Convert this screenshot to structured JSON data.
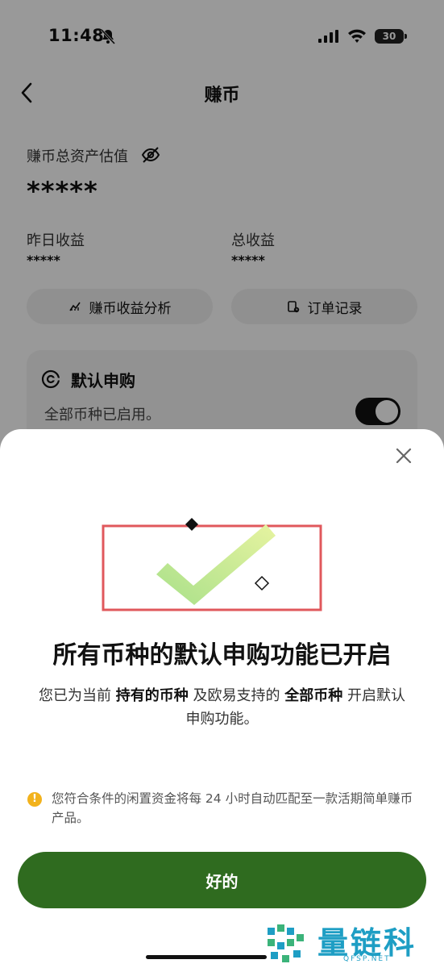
{
  "status_bar": {
    "time": "11:48",
    "battery": "30"
  },
  "nav": {
    "title": "赚币"
  },
  "assets": {
    "total_label": "赚币总资产估值",
    "total_value": "*****",
    "yesterday_label": "昨日收益",
    "yesterday_value": "*****",
    "total_earnings_label": "总收益",
    "total_earnings_value": "*****"
  },
  "actions": {
    "analysis_label": "赚币收益分析",
    "orders_label": "订单记录"
  },
  "default_subscribe": {
    "title": "默认申购",
    "status": "全部币种已启用。",
    "enabled": true
  },
  "sheet": {
    "title": "所有币种的默认申购功能已开启",
    "desc_part1": "您已为当前 ",
    "desc_bold1": "持有的币种",
    "desc_part2": " 及欧易支持的 ",
    "desc_bold2": "全部币种",
    "desc_part3": " 开启默认申购功能。",
    "notice_icon": "!",
    "notice": "您符合条件的闲置资金将每 24 小时自动匹配至一款活期简单赚币产品。",
    "ok_label": "好的"
  },
  "watermark": {
    "name": "量链科技",
    "domain": "QFSP.NET"
  },
  "colors": {
    "primary_button": "#2f6b1f",
    "notice_icon": "#f2b21c",
    "highlight_box": "#e0585c"
  }
}
